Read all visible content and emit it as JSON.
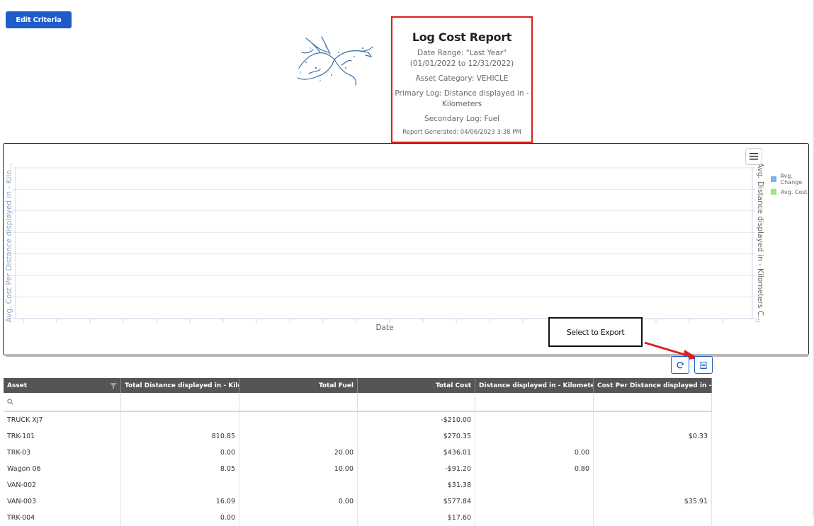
{
  "toolbar": {
    "edit_criteria_label": "Edit Criteria"
  },
  "report": {
    "title": "Log Cost Report",
    "date_range": "Date Range: \"Last Year\" (01/01/2022 to 12/31/2022)",
    "asset_category": "Asset Category: VEHICLE",
    "primary_log": "Primary Log: Distance displayed in - Kilometers",
    "secondary_log": "Secondary Log: Fuel",
    "generated": "Report Generated: 04/06/2023 3:38 PM"
  },
  "chart": {
    "menu_icon": "hamburger-menu-icon",
    "y_left_label": "Avg. Cost Per Distance displayed in - Kilo...",
    "y_right_label": "Avg. Distance displayed in - Kilometers C...",
    "x_label": "Date",
    "legend": [
      {
        "label": "Avg. Change",
        "color": "#7cb5ec"
      },
      {
        "label": "Avg. Cost",
        "color": "#90ed7d"
      }
    ]
  },
  "callout": {
    "text": "Select to Export",
    "arrow_color": "#e02020"
  },
  "tools": {
    "refresh_icon": "refresh-icon",
    "export_icon": "export-icon"
  },
  "grid": {
    "columns": [
      "Asset",
      "Total Distance displayed in - Kilom...",
      "Total Fuel",
      "Total Cost",
      "Distance displayed in - Kilometers ...",
      "Cost Per Distance displayed in - Kil..."
    ],
    "rows": [
      [
        "TRUCK XJ7",
        "",
        "",
        "-$210.00",
        "",
        ""
      ],
      [
        "TRK-101",
        "810.85",
        "",
        "$270.35",
        "",
        "$0.33"
      ],
      [
        "TRK-03",
        "0.00",
        "20.00",
        "$436.01",
        "0.00",
        ""
      ],
      [
        "Wagon 06",
        "8.05",
        "10.00",
        "-$91.20",
        "0.80",
        ""
      ],
      [
        "VAN-002",
        "",
        "",
        "$31.38",
        "",
        ""
      ],
      [
        "VAN-003",
        "16.09",
        "0.00",
        "$577.84",
        "",
        "$35.91"
      ],
      [
        "TRK-004",
        "0.00",
        "",
        "$17.60",
        "",
        ""
      ]
    ]
  }
}
